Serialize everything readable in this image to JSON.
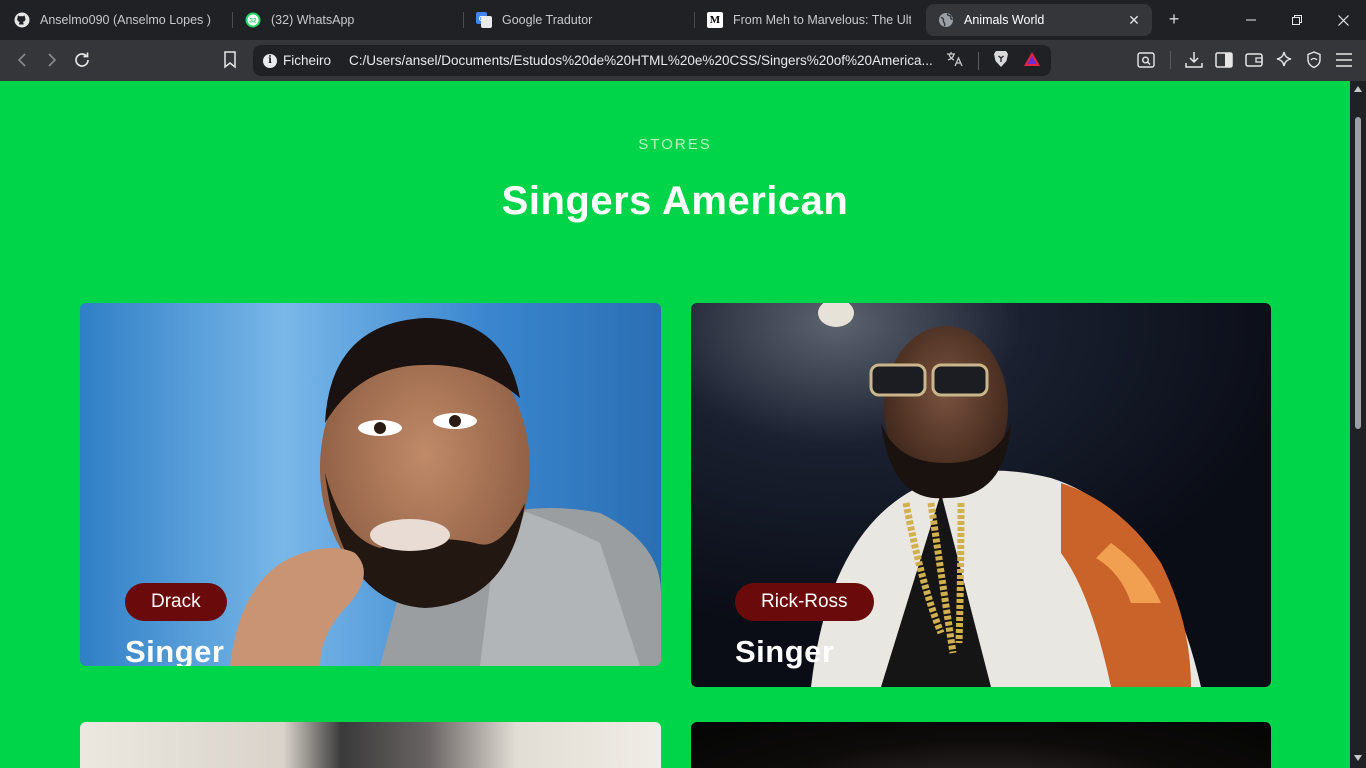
{
  "browser": {
    "tabs": [
      {
        "title": "Anselmo090 (Anselmo Lopes )",
        "icon": "github-icon"
      },
      {
        "title": "(32) WhatsApp",
        "icon": "whatsapp-icon",
        "badge": "32"
      },
      {
        "title": "Google Tradutor",
        "icon": "google-translate-icon"
      },
      {
        "title": "From Meh to Marvelous: The Ultim",
        "icon": "medium-icon",
        "glyph": "M"
      },
      {
        "title": "Animals World",
        "icon": "globe-icon",
        "active": true
      }
    ],
    "address": {
      "scheme_label": "Ficheiro",
      "url": "C:/Users/ansel/Documents/Estudos%20de%20HTML%20e%20CSS/Singers%20of%20America..."
    }
  },
  "page": {
    "eyebrow": "STORES",
    "heading": "Singers American",
    "cards": [
      {
        "name": "Drack",
        "role": "Singer"
      },
      {
        "name": "Rick-Ross",
        "role": "Singer"
      }
    ]
  },
  "colors": {
    "page_bg": "#00d449",
    "chip_bg": "#6b0a0a",
    "browser_bg": "#202124",
    "toolbar_bg": "#35363a"
  }
}
